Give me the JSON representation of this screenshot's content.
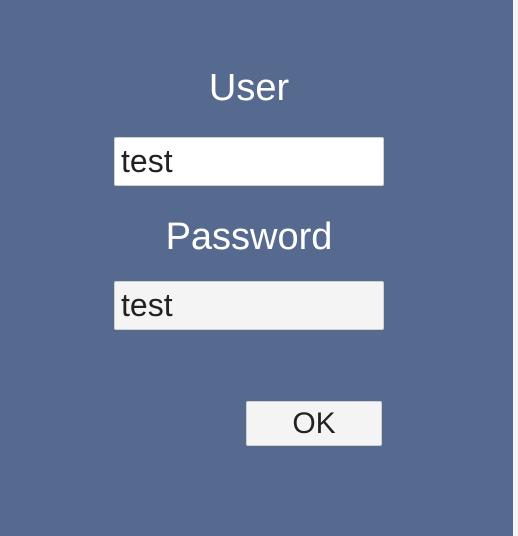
{
  "login_form": {
    "user_label": "User",
    "user_value": "test",
    "password_label": "Password",
    "password_value": "test",
    "ok_label": "OK"
  },
  "colors": {
    "background": "#566a8f",
    "label_text": "#ffffff",
    "field_background": "#ffffff",
    "focused_field_background": "#f4f4f4",
    "button_background": "#f4f4f4",
    "input_text": "#222222"
  }
}
